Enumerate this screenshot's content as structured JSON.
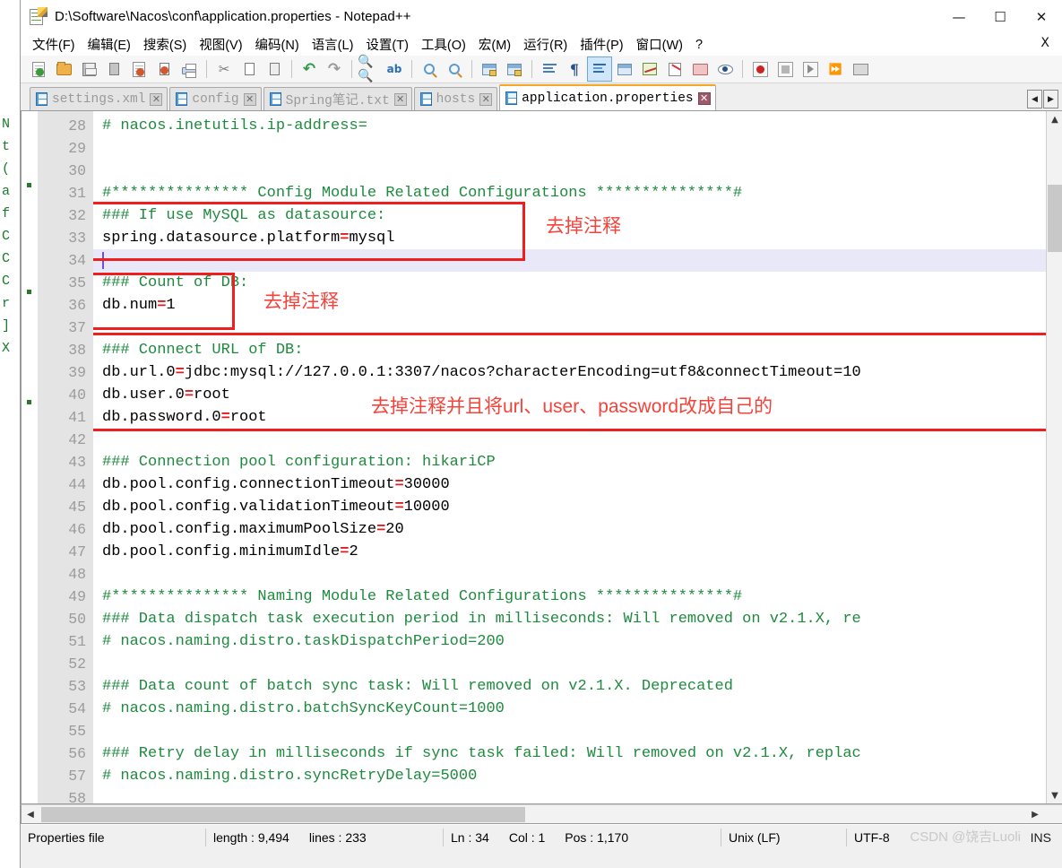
{
  "window": {
    "title": "D:\\Software\\Nacos\\conf\\application.properties - Notepad++",
    "icon": "notepad-plus-plus-icon",
    "minimize": "—",
    "maximize": "☐",
    "close": "✕"
  },
  "menubar": {
    "items": [
      "文件(F)",
      "编辑(E)",
      "搜索(S)",
      "视图(V)",
      "编码(N)",
      "语言(L)",
      "设置(T)",
      "工具(O)",
      "宏(M)",
      "运行(R)",
      "插件(P)",
      "窗口(W)",
      "?"
    ],
    "close_doc": "X"
  },
  "toolbar": {
    "buttons": [
      "new-file-icon",
      "open-file-icon",
      "save-icon",
      "save-all-icon",
      "close-file-icon",
      "close-all-files-icon",
      "print-icon",
      "cut-icon",
      "copy-icon",
      "paste-icon",
      "undo-icon",
      "redo-icon",
      "find-icon",
      "replace-icon",
      "zoom-in-icon",
      "zoom-out-icon",
      "sync-vertical-scroll-icon",
      "sync-horizontal-scroll-icon",
      "word-wrap-icon",
      "show-all-characters-icon",
      "indent-guide-icon",
      "user-defined-language-icon",
      "document-map-icon",
      "function-list-icon",
      "folder-as-workspace-icon",
      "monitoring-icon",
      "record-macro-icon",
      "stop-recording-icon",
      "play-macro-icon",
      "run-macro-multiple-icon",
      "save-macro-icon"
    ]
  },
  "tabs": [
    {
      "label": "settings.xml",
      "active": false,
      "close": "✕"
    },
    {
      "label": "config",
      "active": false,
      "close": "✕"
    },
    {
      "label": "Spring笔记.txt",
      "active": false,
      "close": "✕"
    },
    {
      "label": "hosts",
      "active": false,
      "close": "✕"
    },
    {
      "label": "application.properties",
      "active": true,
      "close": "✕"
    }
  ],
  "tab_nav": {
    "prev": "◀",
    "next": "▶"
  },
  "editor": {
    "first_line_number": 28,
    "current_line": 34,
    "lines": [
      {
        "n": 28,
        "segments": [
          {
            "t": "# nacos.inetutils.ip-address=",
            "c": "cmt"
          }
        ]
      },
      {
        "n": 29,
        "segments": []
      },
      {
        "n": 30,
        "segments": []
      },
      {
        "n": 31,
        "segments": [
          {
            "t": "#*************** Config Module Related Configurations ***************#",
            "c": "cmt"
          }
        ]
      },
      {
        "n": 32,
        "segments": [
          {
            "t": "### If use MySQL as datasource:",
            "c": "cmt"
          }
        ]
      },
      {
        "n": 33,
        "segments": [
          {
            "t": "spring.datasource.platform",
            "c": "key"
          },
          {
            "t": "=",
            "c": "eq"
          },
          {
            "t": "mysql",
            "c": "val"
          }
        ]
      },
      {
        "n": 34,
        "segments": []
      },
      {
        "n": 35,
        "segments": [
          {
            "t": "### Count of DB:",
            "c": "cmt"
          }
        ]
      },
      {
        "n": 36,
        "segments": [
          {
            "t": "db.num",
            "c": "key"
          },
          {
            "t": "=",
            "c": "eq"
          },
          {
            "t": "1",
            "c": "val"
          }
        ]
      },
      {
        "n": 37,
        "segments": []
      },
      {
        "n": 38,
        "segments": [
          {
            "t": "### Connect URL of DB:",
            "c": "cmt"
          }
        ]
      },
      {
        "n": 39,
        "segments": [
          {
            "t": "db.url.0",
            "c": "key"
          },
          {
            "t": "=",
            "c": "eq"
          },
          {
            "t": "jdbc:mysql://127.0.0.1:3307/nacos?characterEncoding=utf8&connectTimeout=10",
            "c": "val"
          }
        ]
      },
      {
        "n": 40,
        "segments": [
          {
            "t": "db.user.0",
            "c": "key"
          },
          {
            "t": "=",
            "c": "eq"
          },
          {
            "t": "root",
            "c": "val"
          }
        ]
      },
      {
        "n": 41,
        "segments": [
          {
            "t": "db.password.0",
            "c": "key"
          },
          {
            "t": "=",
            "c": "eq"
          },
          {
            "t": "root",
            "c": "val"
          }
        ]
      },
      {
        "n": 42,
        "segments": []
      },
      {
        "n": 43,
        "segments": [
          {
            "t": "### Connection pool configuration: hikariCP",
            "c": "cmt"
          }
        ]
      },
      {
        "n": 44,
        "segments": [
          {
            "t": "db.pool.config.connectionTimeout",
            "c": "key"
          },
          {
            "t": "=",
            "c": "eq"
          },
          {
            "t": "30000",
            "c": "val"
          }
        ]
      },
      {
        "n": 45,
        "segments": [
          {
            "t": "db.pool.config.validationTimeout",
            "c": "key"
          },
          {
            "t": "=",
            "c": "eq"
          },
          {
            "t": "10000",
            "c": "val"
          }
        ]
      },
      {
        "n": 46,
        "segments": [
          {
            "t": "db.pool.config.maximumPoolSize",
            "c": "key"
          },
          {
            "t": "=",
            "c": "eq"
          },
          {
            "t": "20",
            "c": "val"
          }
        ]
      },
      {
        "n": 47,
        "segments": [
          {
            "t": "db.pool.config.minimumIdle",
            "c": "key"
          },
          {
            "t": "=",
            "c": "eq"
          },
          {
            "t": "2",
            "c": "val"
          }
        ]
      },
      {
        "n": 48,
        "segments": []
      },
      {
        "n": 49,
        "segments": [
          {
            "t": "#*************** Naming Module Related Configurations ***************#",
            "c": "cmt"
          }
        ]
      },
      {
        "n": 50,
        "segments": [
          {
            "t": "### Data dispatch task execution period in milliseconds: Will removed on v2.1.X, re",
            "c": "cmt"
          }
        ]
      },
      {
        "n": 51,
        "segments": [
          {
            "t": "# nacos.naming.distro.taskDispatchPeriod=200",
            "c": "cmt"
          }
        ]
      },
      {
        "n": 52,
        "segments": []
      },
      {
        "n": 53,
        "segments": [
          {
            "t": "### Data count of batch sync task: Will removed on v2.1.X. Deprecated",
            "c": "cmt"
          }
        ]
      },
      {
        "n": 54,
        "segments": [
          {
            "t": "# nacos.naming.distro.batchSyncKeyCount=1000",
            "c": "cmt"
          }
        ]
      },
      {
        "n": 55,
        "segments": []
      },
      {
        "n": 56,
        "segments": [
          {
            "t": "### Retry delay in milliseconds if sync task failed: Will removed on v2.1.X, replac",
            "c": "cmt"
          }
        ]
      },
      {
        "n": 57,
        "segments": [
          {
            "t": "# nacos.naming.distro.syncRetryDelay=5000",
            "c": "cmt"
          }
        ]
      },
      {
        "n": 58,
        "segments": []
      }
    ]
  },
  "annotations": [
    {
      "id": "note-platform",
      "text": "去掉注释"
    },
    {
      "id": "note-dbnum",
      "text": "去掉注释"
    },
    {
      "id": "note-url",
      "text": "去掉注释并且将url、user、password改成自己的"
    }
  ],
  "statusbar": {
    "doc_type": "Properties file",
    "length_label": "length : 9,494",
    "lines_label": "lines : 233",
    "ln": "Ln : 34",
    "col": "Col : 1",
    "pos": "Pos : 1,170",
    "eol": "Unix (LF)",
    "encoding": "UTF-8",
    "insert_mode": "INS",
    "watermark": "CSDN @饶吉Luoli"
  },
  "colors": {
    "comment_green": "#1f8a3f",
    "equals_red": "#e01b1b",
    "annotation_red": "#f4433b",
    "box_red": "#ef1f1f",
    "active_tab_accent": "#f5a623",
    "current_line": "#e8e8f8"
  },
  "behind_window_text": [
    "N",
    "t",
    "",
    "",
    "",
    "",
    "",
    "",
    "",
    "",
    "",
    "(",
    "a",
    "",
    "",
    "",
    "",
    "",
    "",
    "f",
    "C",
    "C",
    "",
    "C",
    "r",
    "]",
    "X"
  ]
}
